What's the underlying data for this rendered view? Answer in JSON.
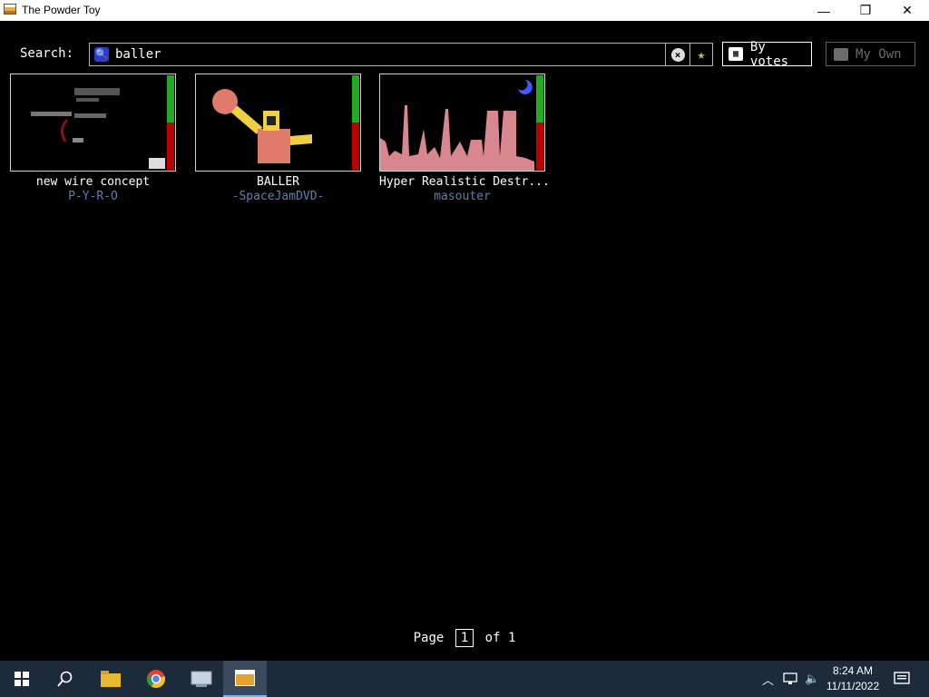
{
  "window": {
    "title": "The Powder Toy",
    "minimize": "—",
    "maximize": "❐",
    "close": "✕"
  },
  "search": {
    "label": "Search:",
    "query": "baller",
    "icon": "search-icon",
    "clear_icon": "clear-icon",
    "favorite_icon": "star-icon"
  },
  "sort": {
    "label": "By votes",
    "icon": "sort-icon"
  },
  "mine": {
    "label": "My Own",
    "icon": "folder-icon"
  },
  "saves": [
    {
      "name": "new wire concept",
      "author": "P-Y-R-O",
      "score_fraction": 0.5
    },
    {
      "name": "BALLER",
      "author": "-SpaceJamDVD-",
      "score_fraction": 0.5
    },
    {
      "name": "Hyper Realistic Destr...",
      "author": "masouter",
      "score_fraction": 0.5
    }
  ],
  "pagination": {
    "page_label": "Page",
    "current": "1",
    "of_label": "of",
    "total": "1"
  },
  "taskbar": {
    "items": [
      "start-icon",
      "search-icon",
      "file-explorer-icon",
      "chrome-icon",
      "app-icon",
      "powder-toy-icon"
    ],
    "clock_time": "8:24 AM",
    "clock_date": "11/11/2022"
  }
}
